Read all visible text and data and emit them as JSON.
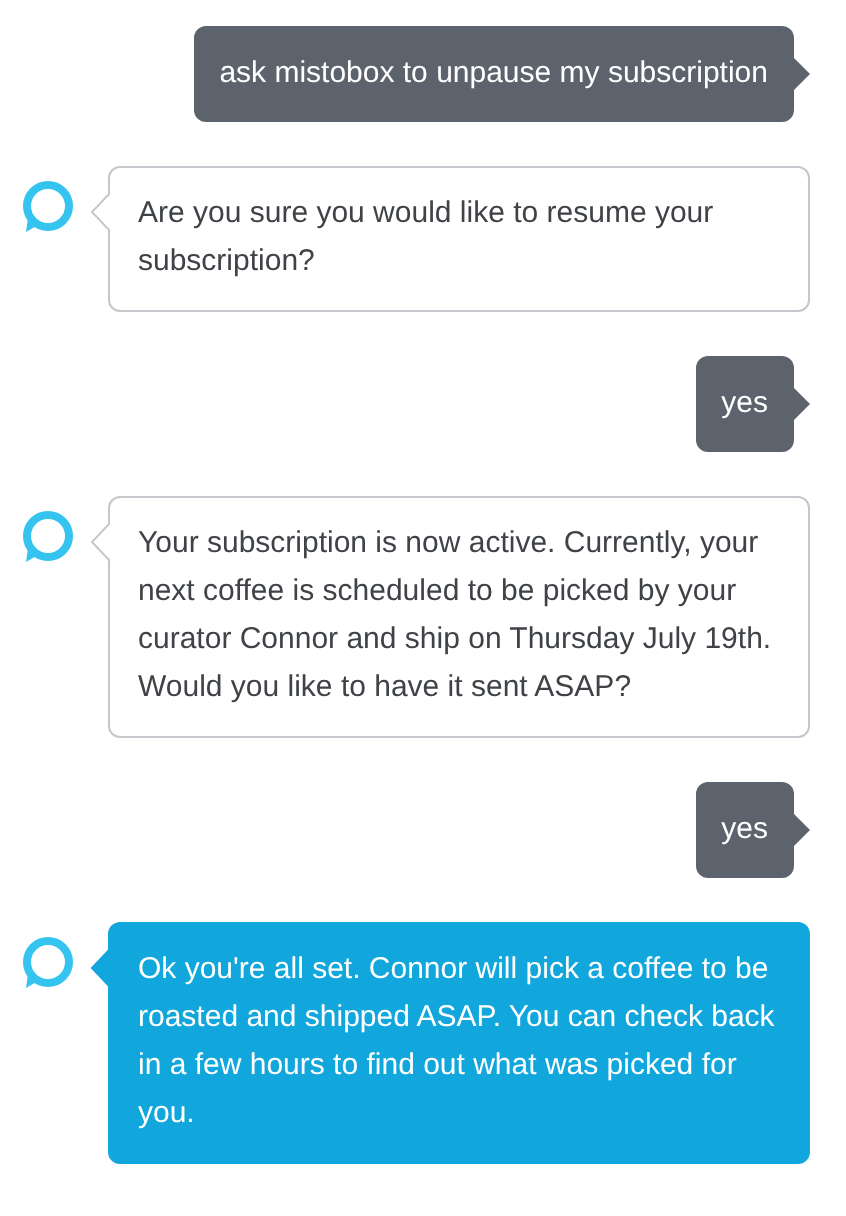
{
  "messages": [
    {
      "kind": "user",
      "text": "ask mistobox to unpause my subscription"
    },
    {
      "kind": "alexa",
      "highlighted": false,
      "text": "Are you sure you would like to resume your subscription?"
    },
    {
      "kind": "user",
      "text": "yes"
    },
    {
      "kind": "alexa",
      "highlighted": false,
      "text": "Your subscription is now active. Currently, your next coffee is scheduled to be picked by your curator Connor and ship on Thursday July 19th. Would you like to have it sent ASAP?"
    },
    {
      "kind": "user",
      "text": "yes"
    },
    {
      "kind": "alexa",
      "highlighted": true,
      "text": "Ok you're all set. Connor will pick a coffee to be roasted and shipped ASAP. You can check back in a few hours to find out what was picked for you."
    }
  ]
}
